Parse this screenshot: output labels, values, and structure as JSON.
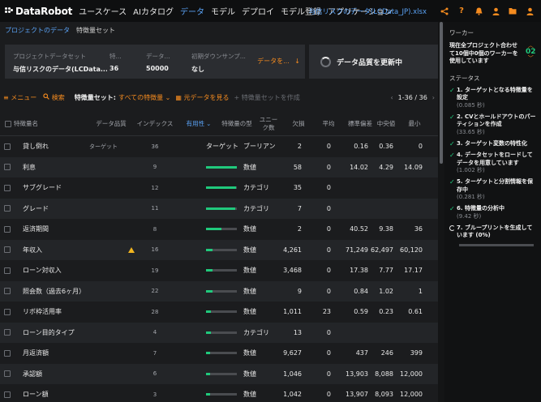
{
  "app": {
    "logo_brand": "DataRobot",
    "nav": [
      "ユースケース",
      "AIカタログ",
      "データ",
      "モデル",
      "デプロイ",
      "モデル登録",
      "アプリケーション"
    ],
    "nav_active": 2,
    "dataset_link": "与信リスクのデータ(LCData_JP).xlsx"
  },
  "breadcrumb": {
    "project": "プロジェクトのデータ",
    "current": "特徴量セット"
  },
  "info": {
    "project_dataset_label": "プロジェクトデータセット",
    "project_dataset_value": "与信リスクのデータ(LCData...",
    "features_label": "特...",
    "features_value": "36",
    "rows_label": "データ...",
    "rows_value": "50000",
    "downsample_label": "初期ダウンサンプ...",
    "downsample_value": "なし",
    "data_menu": "データを...",
    "quality_button": "データ品質を更新中"
  },
  "toolbar": {
    "menu": "メニュー",
    "search": "検索",
    "feature_set_label": "特徴量セット:",
    "feature_set_value": "すべての特徴量",
    "view_raw": "元データを見る",
    "create_set": "特徴量セットを作成",
    "pagination": "1-36 / 36"
  },
  "table": {
    "headers": {
      "name": "特徴量名",
      "quality": "データ品質",
      "index": "インデックス",
      "importance": "有用性",
      "type": "特徴量の型",
      "unique": "ユニーク数",
      "missing": "欠損",
      "mean": "平均",
      "std": "標準偏差",
      "median": "中央値",
      "min": "最小"
    },
    "rows": [
      {
        "name": "貸し倒れ",
        "quality_warning": false,
        "target_tag": "ターゲット",
        "index": "36",
        "importance": null,
        "importance_label": "ターゲット",
        "type": "ブーリアン",
        "unique": "2",
        "missing": "0",
        "mean": "0.16",
        "median": "0.36",
        "min": "0"
      },
      {
        "name": "利息",
        "quality_warning": false,
        "target_tag": "",
        "index": "9",
        "importance": 1.0,
        "importance_label": "",
        "type": "数値",
        "unique": "58",
        "missing": "0",
        "mean": "14.02",
        "median": "4.29",
        "min": "14.09"
      },
      {
        "name": "サブグレード",
        "quality_warning": false,
        "target_tag": "",
        "index": "12",
        "importance": 0.97,
        "importance_label": "",
        "type": "カテゴリ",
        "unique": "35",
        "missing": "0",
        "mean": "",
        "median": "",
        "min": ""
      },
      {
        "name": "グレード",
        "quality_warning": false,
        "target_tag": "",
        "index": "11",
        "importance": 0.95,
        "importance_label": "",
        "type": "カテゴリ",
        "unique": "7",
        "missing": "0",
        "mean": "",
        "median": "",
        "min": ""
      },
      {
        "name": "返済期間",
        "quality_warning": false,
        "target_tag": "",
        "index": "8",
        "importance": 0.5,
        "importance_label": "",
        "type": "数値",
        "unique": "2",
        "missing": "0",
        "mean": "40.52",
        "median": "9.38",
        "min": "36"
      },
      {
        "name": "年収入",
        "quality_warning": true,
        "target_tag": "",
        "index": "16",
        "importance": 0.22,
        "importance_label": "",
        "type": "数値",
        "unique": "4,261",
        "missing": "0",
        "mean": "71,249",
        "median": "62,497",
        "min": "60,120"
      },
      {
        "name": "ローン対収入",
        "quality_warning": false,
        "target_tag": "",
        "index": "19",
        "importance": 0.2,
        "importance_label": "",
        "type": "数値",
        "unique": "3,468",
        "missing": "0",
        "mean": "17.38",
        "median": "7.77",
        "min": "17.17"
      },
      {
        "name": "照会数（過去6ヶ月）",
        "quality_warning": false,
        "target_tag": "",
        "index": "22",
        "importance": 0.2,
        "importance_label": "",
        "type": "数値",
        "unique": "9",
        "missing": "0",
        "mean": "0.84",
        "median": "1.02",
        "min": "1"
      },
      {
        "name": "リボ枠活用率",
        "quality_warning": false,
        "target_tag": "",
        "index": "28",
        "importance": 0.16,
        "importance_label": "",
        "type": "数値",
        "unique": "1,011",
        "missing": "23",
        "mean": "0.59",
        "median": "0.23",
        "min": "0.61"
      },
      {
        "name": "ローン目的タイプ",
        "quality_warning": false,
        "target_tag": "",
        "index": "4",
        "importance": 0.16,
        "importance_label": "",
        "type": "カテゴリ",
        "unique": "13",
        "missing": "0",
        "mean": "",
        "median": "",
        "min": ""
      },
      {
        "name": "月返済額",
        "quality_warning": false,
        "target_tag": "",
        "index": "7",
        "importance": 0.14,
        "importance_label": "",
        "type": "数値",
        "unique": "9,627",
        "missing": "0",
        "mean": "437",
        "median": "246",
        "min": "399"
      },
      {
        "name": "承認額",
        "quality_warning": false,
        "target_tag": "",
        "index": "6",
        "importance": 0.14,
        "importance_label": "",
        "type": "数値",
        "unique": "1,046",
        "missing": "0",
        "mean": "13,903",
        "median": "8,088",
        "min": "12,000"
      },
      {
        "name": "ローン額",
        "quality_warning": false,
        "target_tag": "",
        "index": "3",
        "importance": 0.14,
        "importance_label": "",
        "type": "数値",
        "unique": "1,042",
        "missing": "0",
        "mean": "13,907",
        "median": "8,093",
        "min": "12,000"
      }
    ]
  },
  "sidebar": {
    "worker_heading": "ワーカー",
    "worker_text": "現在全プロジェクト合わせて10個中0個のワーカーを使用しています",
    "worker_count": "02",
    "status_heading": "ステータス",
    "steps": [
      {
        "text": "1. ターゲットとなる特徴量を設定",
        "time": "(0.085 秒)",
        "done": true
      },
      {
        "text": "2. CVとホールドアウトのパーティションを作成",
        "time": "(33.65 秒)",
        "done": true
      },
      {
        "text": "3. ターゲット変数の特性化",
        "time": "",
        "done": true
      },
      {
        "text": "4. データセットをロードしてデータを用意しています",
        "time": "(1.002 秒)",
        "done": true
      },
      {
        "text": "5. ターゲットと分割情報を保存中",
        "time": "(0.281 秒)",
        "done": true
      },
      {
        "text": "6. 特徴量の分析中",
        "time": "(9.42 秒)",
        "done": true
      },
      {
        "text": "7. ブループリントを生成しています (0%)",
        "time": "",
        "done": false
      }
    ],
    "blueprint_progress": 0
  },
  "colors": {
    "accent": "#f58b1f",
    "link": "#5aa2f5",
    "success": "#20c97c",
    "warning": "#f1b51f"
  }
}
